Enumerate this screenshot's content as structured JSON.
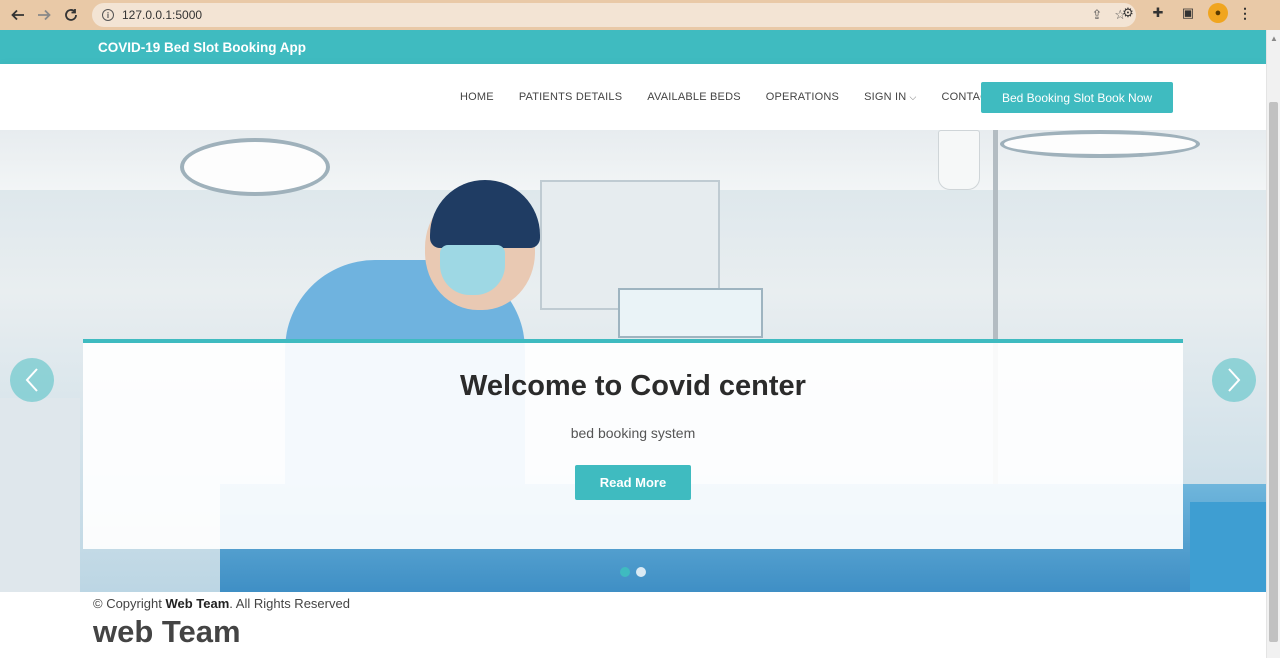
{
  "browser": {
    "url": "127.0.0.1:5000",
    "accent_color": "#e9c9a7"
  },
  "site": {
    "brand": "COVID-19 Bed Slot Booking App",
    "theme_color": "#3fbbc0"
  },
  "nav": {
    "items": [
      {
        "label": "HOME"
      },
      {
        "label": "PATIENTS DETAILS"
      },
      {
        "label": "AVAILABLE BEDS"
      },
      {
        "label": "OPERATIONS"
      },
      {
        "label": "SIGN IN"
      },
      {
        "label": "CONTACT"
      }
    ],
    "cta_label": "Bed Booking Slot Book Now"
  },
  "hero": {
    "title": "Welcome to Covid center",
    "subtitle": "bed booking system",
    "button_label": "Read More",
    "prev_icon": "chevron-left-icon",
    "next_icon": "chevron-right-icon"
  },
  "footer": {
    "copyright_prefix": "© Copyright ",
    "copyright_owner": "Web Team",
    "copyright_suffix": ". All Rights Reserved",
    "team_name": "web Team"
  }
}
